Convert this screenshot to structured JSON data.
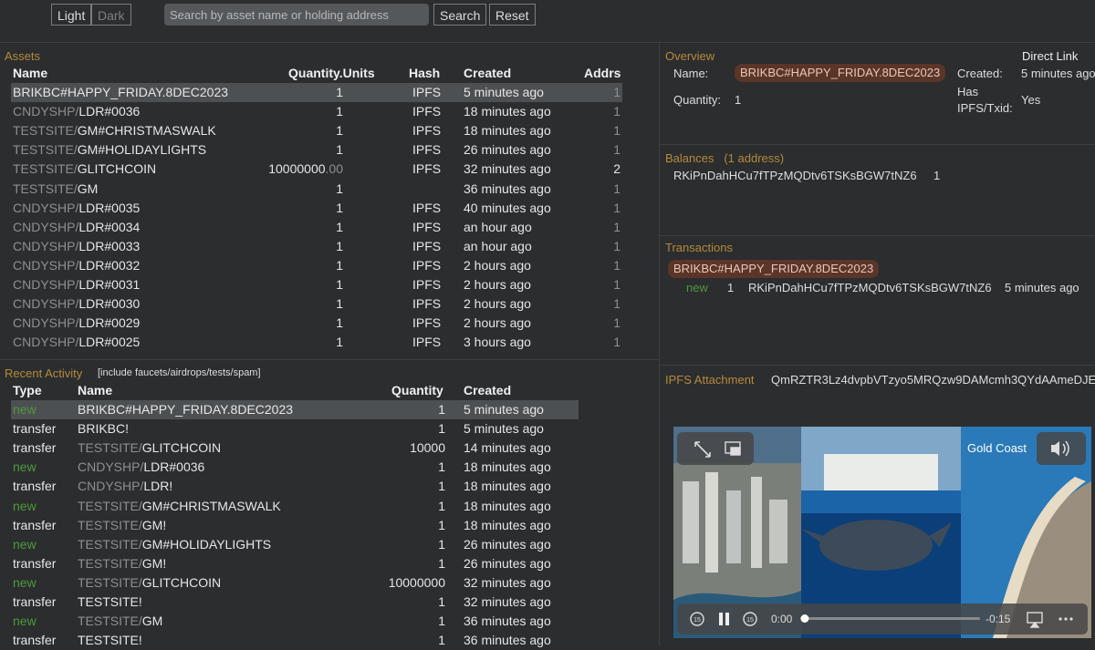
{
  "toolbar": {
    "light_label": "Light",
    "dark_label": "Dark",
    "search_placeholder": "Search by asset name or holding address",
    "search_label": "Search",
    "reset_label": "Reset"
  },
  "assets": {
    "title": "Assets",
    "headers": [
      "Name",
      "Quantity.Units",
      "Hash",
      "Created",
      "Addrs"
    ],
    "rows": [
      {
        "prefix": "",
        "name": "BRIKBC#HAPPY_FRIDAY.8DEC2023",
        "qty": "1",
        "qty_dec": "",
        "hash": "IPFS",
        "created": "5 minutes ago",
        "addrs": "1"
      },
      {
        "prefix": "CNDYSHP/",
        "name": "LDR#0036",
        "qty": "1",
        "qty_dec": "",
        "hash": "IPFS",
        "created": "18 minutes ago",
        "addrs": "1"
      },
      {
        "prefix": "TESTSITE/",
        "name": "GM#CHRISTMASWALK",
        "qty": "1",
        "qty_dec": "",
        "hash": "IPFS",
        "created": "18 minutes ago",
        "addrs": "1"
      },
      {
        "prefix": "TESTSITE/",
        "name": "GM#HOLIDAYLIGHTS",
        "qty": "1",
        "qty_dec": "",
        "hash": "IPFS",
        "created": "26 minutes ago",
        "addrs": "1"
      },
      {
        "prefix": "TESTSITE/",
        "name": "GLITCHCOIN",
        "qty": "10000000",
        "qty_dec": ".00",
        "hash": "IPFS",
        "created": "32 minutes ago",
        "addrs": "2"
      },
      {
        "prefix": "TESTSITE/",
        "name": "GM",
        "qty": "1",
        "qty_dec": "",
        "hash": "",
        "created": "36 minutes ago",
        "addrs": "1"
      },
      {
        "prefix": "CNDYSHP/",
        "name": "LDR#0035",
        "qty": "1",
        "qty_dec": "",
        "hash": "IPFS",
        "created": "40 minutes ago",
        "addrs": "1"
      },
      {
        "prefix": "CNDYSHP/",
        "name": "LDR#0034",
        "qty": "1",
        "qty_dec": "",
        "hash": "IPFS",
        "created": "an hour ago",
        "addrs": "1"
      },
      {
        "prefix": "CNDYSHP/",
        "name": "LDR#0033",
        "qty": "1",
        "qty_dec": "",
        "hash": "IPFS",
        "created": "an hour ago",
        "addrs": "1"
      },
      {
        "prefix": "CNDYSHP/",
        "name": "LDR#0032",
        "qty": "1",
        "qty_dec": "",
        "hash": "IPFS",
        "created": "2 hours ago",
        "addrs": "1"
      },
      {
        "prefix": "CNDYSHP/",
        "name": "LDR#0031",
        "qty": "1",
        "qty_dec": "",
        "hash": "IPFS",
        "created": "2 hours ago",
        "addrs": "1"
      },
      {
        "prefix": "CNDYSHP/",
        "name": "LDR#0030",
        "qty": "1",
        "qty_dec": "",
        "hash": "IPFS",
        "created": "2 hours ago",
        "addrs": "1"
      },
      {
        "prefix": "CNDYSHP/",
        "name": "LDR#0029",
        "qty": "1",
        "qty_dec": "",
        "hash": "IPFS",
        "created": "2 hours ago",
        "addrs": "1"
      },
      {
        "prefix": "CNDYSHP/",
        "name": "LDR#0025",
        "qty": "1",
        "qty_dec": "",
        "hash": "IPFS",
        "created": "3 hours ago",
        "addrs": "1"
      }
    ]
  },
  "activity": {
    "title": "Recent Activity",
    "filter_label": "[include faucets/airdrops/tests/spam]",
    "headers": [
      "Type",
      "Name",
      "Quantity",
      "Created"
    ],
    "rows": [
      {
        "type": "new",
        "prefix": "",
        "name": "BRIKBC#HAPPY_FRIDAY.8DEC2023",
        "qty": "1",
        "created": "5 minutes ago"
      },
      {
        "type": "transfer",
        "prefix": "",
        "name": "BRIKBC!",
        "qty": "1",
        "created": "5 minutes ago"
      },
      {
        "type": "transfer",
        "prefix": "TESTSITE/",
        "name": "GLITCHCOIN",
        "qty": "10000",
        "created": "14 minutes ago"
      },
      {
        "type": "new",
        "prefix": "CNDYSHP/",
        "name": "LDR#0036",
        "qty": "1",
        "created": "18 minutes ago"
      },
      {
        "type": "transfer",
        "prefix": "CNDYSHP/",
        "name": "LDR!",
        "qty": "1",
        "created": "18 minutes ago"
      },
      {
        "type": "new",
        "prefix": "TESTSITE/",
        "name": "GM#CHRISTMASWALK",
        "qty": "1",
        "created": "18 minutes ago"
      },
      {
        "type": "transfer",
        "prefix": "TESTSITE/",
        "name": "GM!",
        "qty": "1",
        "created": "18 minutes ago"
      },
      {
        "type": "new",
        "prefix": "TESTSITE/",
        "name": "GM#HOLIDAYLIGHTS",
        "qty": "1",
        "created": "26 minutes ago"
      },
      {
        "type": "transfer",
        "prefix": "TESTSITE/",
        "name": "GM!",
        "qty": "1",
        "created": "26 minutes ago"
      },
      {
        "type": "new",
        "prefix": "TESTSITE/",
        "name": "GLITCHCOIN",
        "qty": "10000000",
        "created": "32 minutes ago"
      },
      {
        "type": "transfer",
        "prefix": "",
        "name": "TESTSITE!",
        "qty": "1",
        "created": "32 minutes ago"
      },
      {
        "type": "new",
        "prefix": "TESTSITE/",
        "name": "GM",
        "qty": "1",
        "created": "36 minutes ago"
      },
      {
        "type": "transfer",
        "prefix": "",
        "name": "TESTSITE!",
        "qty": "1",
        "created": "36 minutes ago"
      }
    ]
  },
  "overview": {
    "title": "Overview",
    "direct_link": "Direct Link",
    "name_label": "Name:",
    "name_value": "BRIKBC#HAPPY_FRIDAY.8DEC2023",
    "created_label": "Created:",
    "created_value": "5 minutes ago",
    "quantity_label": "Quantity:",
    "quantity_value": "1",
    "has_ipfs_label_1": "Has",
    "has_ipfs_label_2": "IPFS/Txid:",
    "has_ipfs_value": "Yes"
  },
  "balances": {
    "title": "Balances",
    "count": "(1 address)",
    "address": "RKiPnDahHCu7fTPzMQDtv6TSKsBGW7tNZ6",
    "amount": "1"
  },
  "transactions": {
    "title": "Transactions",
    "asset": "BRIKBC#HAPPY_FRIDAY.8DEC2023",
    "type": "new",
    "qty": "1",
    "address": "RKiPnDahHCu7fTPzMQDtv6TSKsBGW7tNZ6",
    "time": "5 minutes ago"
  },
  "ipfs": {
    "title": "IPFS Attachment",
    "hash": "QmRZTR3Lz4dvpbVTzyo5MRQzw9DAMcmh3QYdAAmeDJE"
  },
  "video": {
    "overlay_text": "Gold Coast",
    "current_time": "0:00",
    "remaining": "-0:15",
    "skip_back": "15",
    "skip_fwd": "15",
    "progress": 0.02
  }
}
